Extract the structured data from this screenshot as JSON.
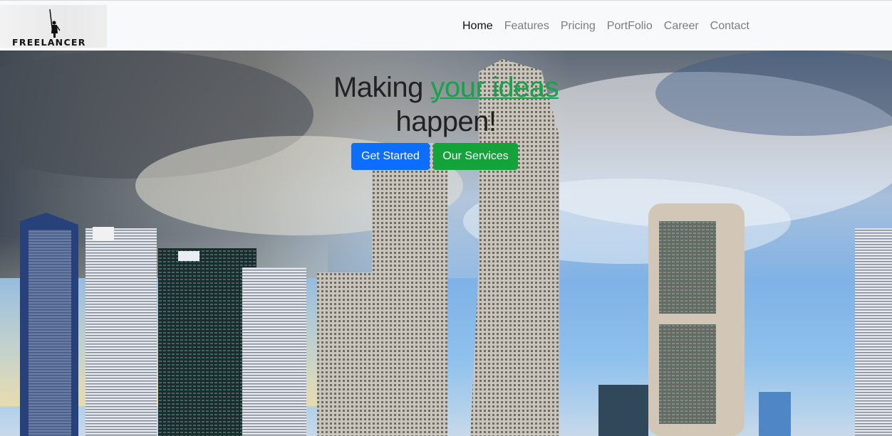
{
  "brand": {
    "name": "FREELANCER"
  },
  "nav": {
    "items": [
      {
        "label": "Home",
        "active": true
      },
      {
        "label": "Features",
        "active": false
      },
      {
        "label": "Pricing",
        "active": false
      },
      {
        "label": "PortFolio",
        "active": false
      },
      {
        "label": "Career",
        "active": false
      },
      {
        "label": "Contact",
        "active": false
      }
    ]
  },
  "hero": {
    "title_prefix": "Making ",
    "title_accent": "your ideas",
    "title_suffix": "happen!",
    "buttons": {
      "get_started": "Get Started",
      "our_services": "Our Services"
    }
  },
  "colors": {
    "accent_green": "#16a34a",
    "primary_blue": "#0d6efd",
    "success_green": "#13a33a",
    "nav_bg": "#f8f9fa"
  }
}
